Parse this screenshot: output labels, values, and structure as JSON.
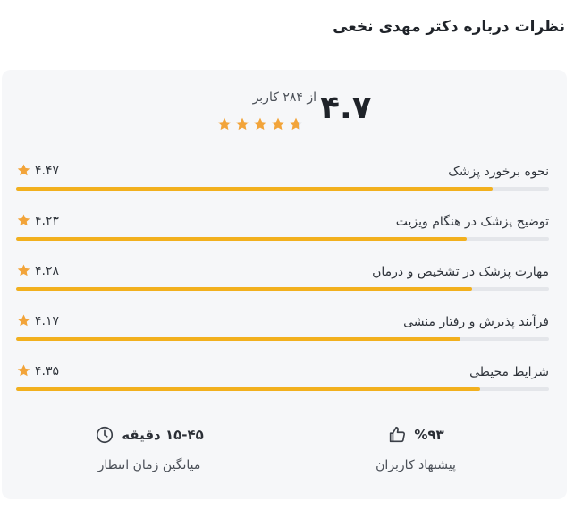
{
  "header": {
    "title": "نظرات درباره دکتر مهدی نخعی"
  },
  "summary": {
    "score": "۴.۷",
    "count_text": "از ۲۸۴ کاربر",
    "stars_filled": 4.7,
    "star_color": "#f2a43a"
  },
  "criteria": [
    {
      "label": "نحوه برخورد پزشک",
      "value": "۴.۴۷",
      "fraction": 0.894
    },
    {
      "label": "توضیح پزشک در هنگام ویزیت",
      "value": "۴.۲۳",
      "fraction": 0.846
    },
    {
      "label": "مهارت پزشک در تشخیص و درمان",
      "value": "۴.۲۸",
      "fraction": 0.856
    },
    {
      "label": "فرآیند پذیرش و رفتار منشی",
      "value": "۴.۱۷",
      "fraction": 0.834
    },
    {
      "label": "شرایط محیطی",
      "value": "۴.۳۵",
      "fraction": 0.87
    }
  ],
  "colors": {
    "bar_fill": "#f2b01e",
    "bar_track": "#e4e6ea",
    "card_bg": "#f6f7f9"
  },
  "stats": {
    "recommend": {
      "value": "%۹۳",
      "label": "پیشنهاد کاربران",
      "icon": "thumbs-up-icon"
    },
    "wait": {
      "value": "۱۵-۴۵ دقیقه",
      "label": "میانگین زمان انتظار",
      "icon": "clock-icon"
    }
  }
}
